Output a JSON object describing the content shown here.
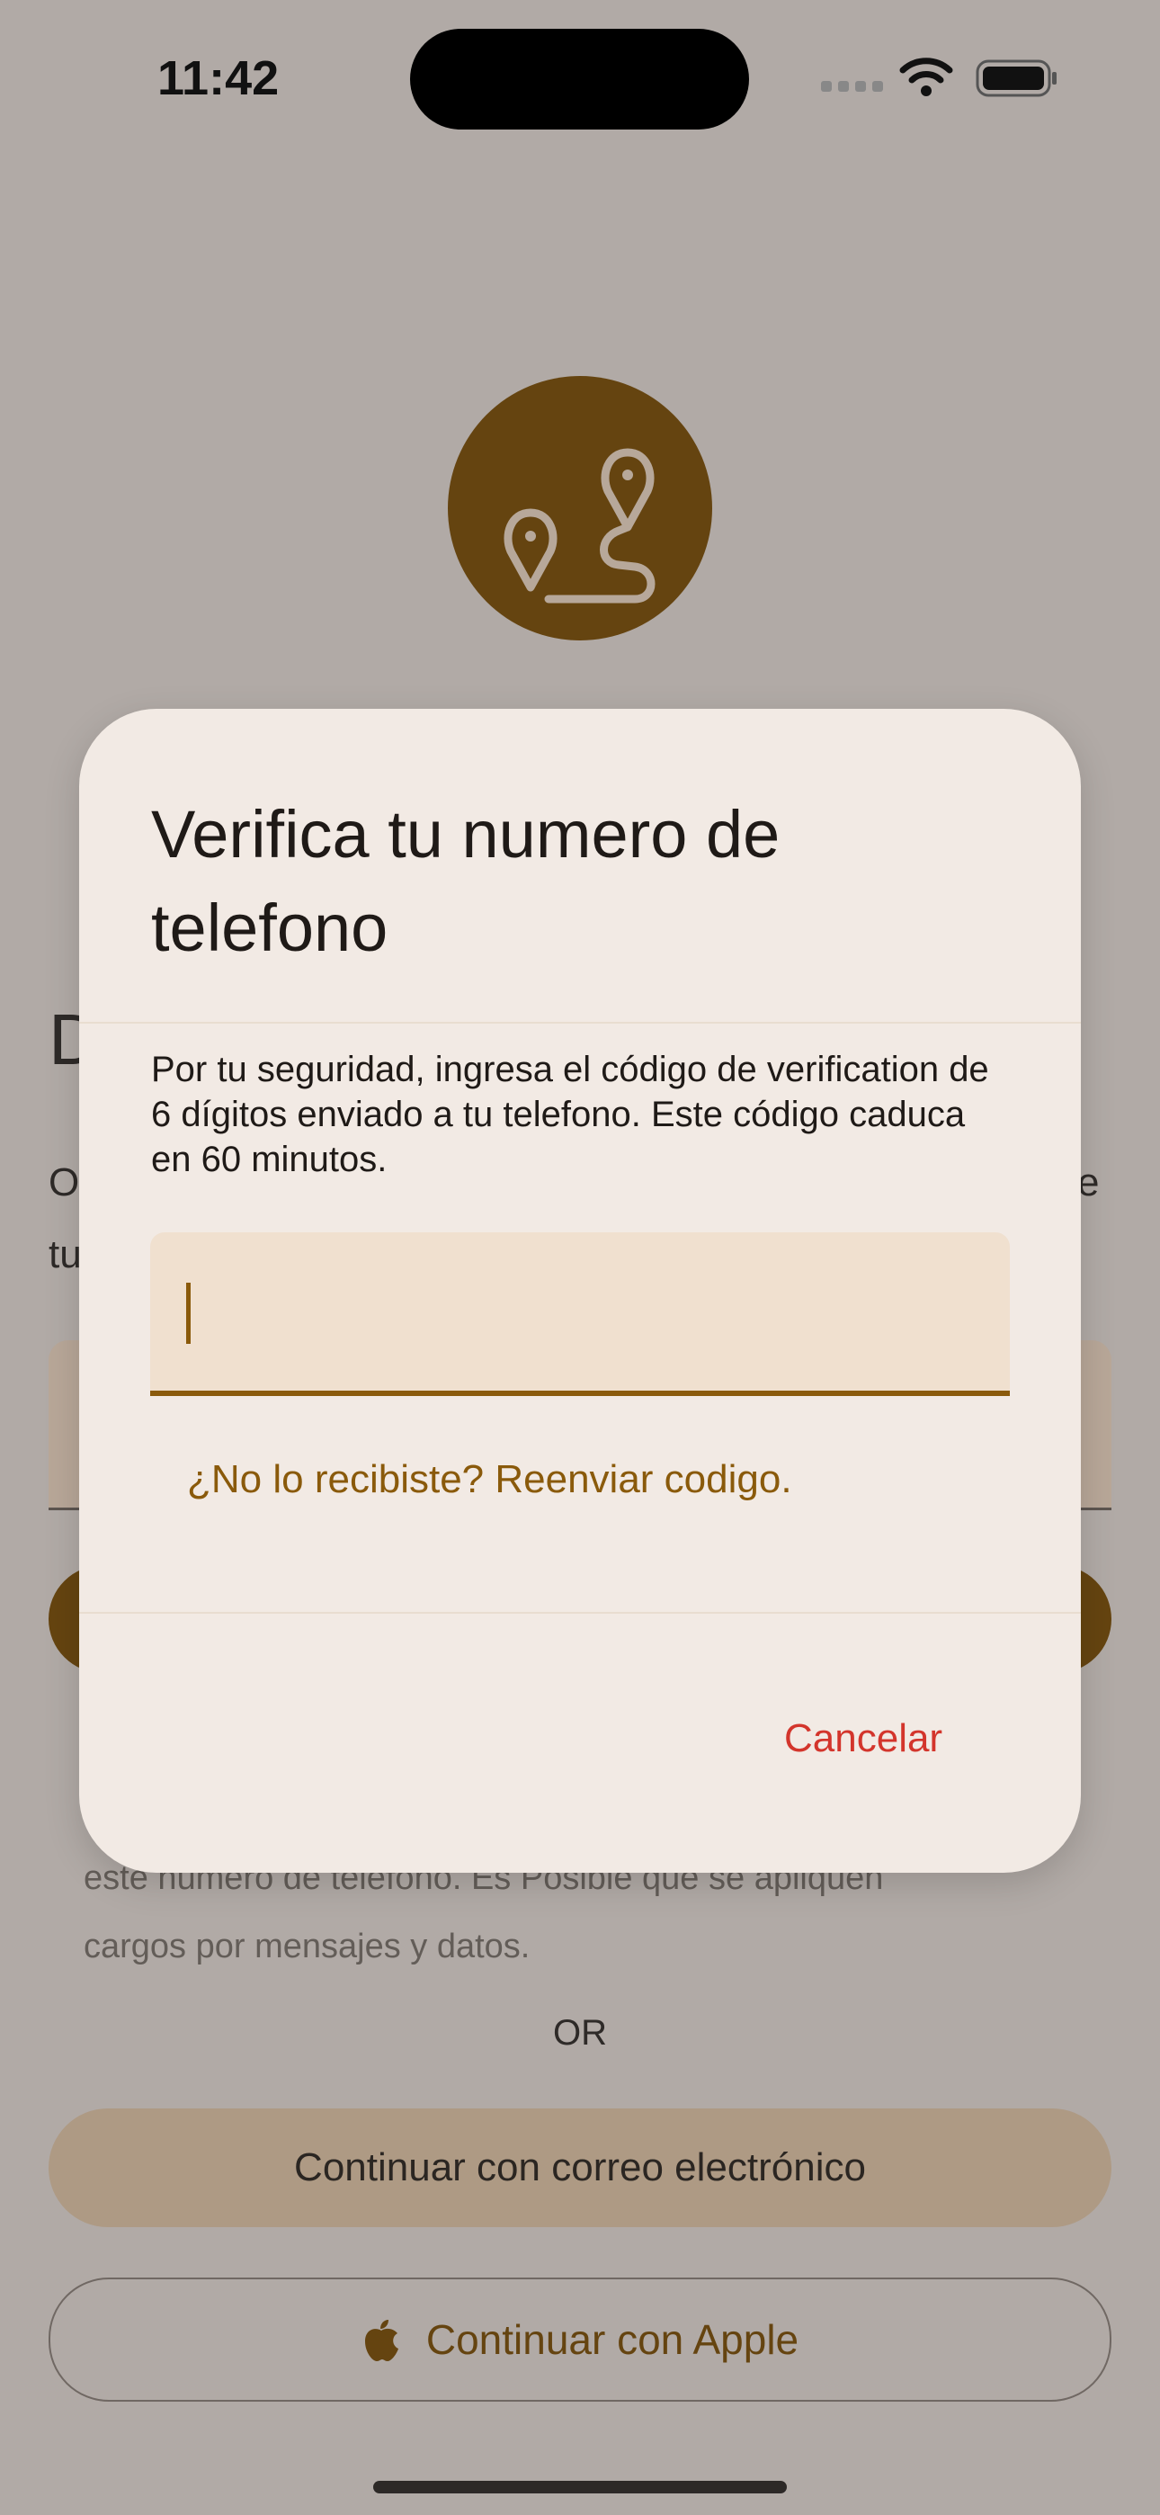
{
  "status_bar": {
    "time": "11:42"
  },
  "background": {
    "heading_fragment": "D",
    "subtitle_left_line1": "O",
    "subtitle_left_line2": "tu",
    "subtitle_right": "e",
    "terms_line1": "este número de teléfono. Es Posible que se apliquen",
    "terms_line2": "cargos por mensajes y datos.",
    "or_label": "OR",
    "email_button_label": "Continuar con correo electrónico",
    "apple_button_label": "Continuar con Apple"
  },
  "dialog": {
    "title": "Verifica tu numero de telefono",
    "body": "Por tu seguridad, ingresa el código de verification de 6 dígitos enviado a tu telefono. Este código caduca en 60 minutos.",
    "code_value": "",
    "resend_label": "¿No lo recibiste? Reenviar codigo.",
    "cancel_label": "Cancelar"
  },
  "colors": {
    "accent": "#654410",
    "link": "#8a5a0b",
    "destructive": "#d3352c",
    "dialog_bg": "#f2eae4",
    "scrim_bg": "#b1aaa6"
  },
  "icons": [
    "route-icon",
    "wifi-icon",
    "battery-icon",
    "apple-icon",
    "signal-icon"
  ]
}
